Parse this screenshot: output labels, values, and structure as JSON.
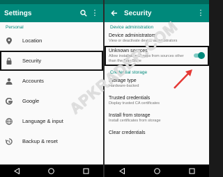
{
  "left": {
    "title": "Settings",
    "section": "Personal",
    "items": [
      {
        "label": "Location",
        "icon": "location-pin-icon"
      },
      {
        "label": "Security",
        "icon": "lock-icon"
      },
      {
        "label": "Accounts",
        "icon": "account-icon"
      },
      {
        "label": "Google",
        "icon": "google-icon"
      },
      {
        "label": "Language & input",
        "icon": "globe-icon"
      },
      {
        "label": "Backup & reset",
        "icon": "backup-icon"
      }
    ]
  },
  "right": {
    "title": "Security",
    "section_device": "Device administration",
    "device_admins_title": "Device administrators",
    "device_admins_sub": "View or deactivate device administrators",
    "unknown_title": "Unknown sources",
    "unknown_sub": "Allow installation of apps from sources other than the Play Store",
    "unknown_enabled": true,
    "section_credential": "Credential storage",
    "storage_type_title": "Storage type",
    "storage_type_sub": "Hardware-backed",
    "trusted_title": "Trusted credentials",
    "trusted_sub": "Display trusted CA certificates",
    "install_title": "Install from storage",
    "install_sub": "Install certificates from storage",
    "clear_title": "Clear credentials"
  },
  "watermark": "APKRADER.COM",
  "colors": {
    "accent": "#00897b",
    "statusbar": "#00695c",
    "highlight": "#111111",
    "arrow": "#e53935"
  }
}
